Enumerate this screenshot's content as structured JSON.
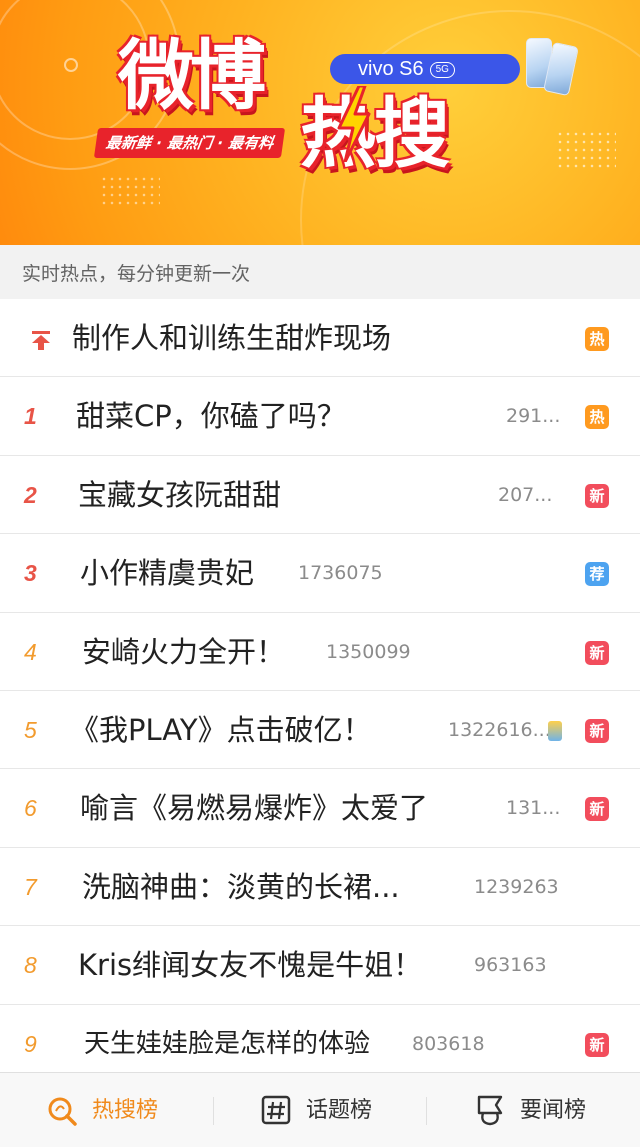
{
  "banner": {
    "title_1": "微博",
    "title_2": "热搜",
    "tagline": "最新鲜 · 最热门 · 最有料",
    "ad_brand": "vivo S6",
    "ad_badge": "5G",
    "colors": {
      "background": "#ffb321",
      "title_outline": "#e8232b",
      "pill": "#3b56e8"
    }
  },
  "subheader": "实时热点，每分钟更新一次",
  "list": [
    {
      "rank": "",
      "pinned": true,
      "title": "制作人和训练生甜炸现场",
      "count": "",
      "badge": "热",
      "badge_type": "hot"
    },
    {
      "rank": "1",
      "title": "甜菜CP，你磕了吗？",
      "count": "291...",
      "badge": "热",
      "badge_type": "hot"
    },
    {
      "rank": "2",
      "title": "宝藏女孩阮甜甜",
      "count": "207...",
      "badge": "新",
      "badge_type": "new"
    },
    {
      "rank": "3",
      "title": "小作精虞贵妃",
      "count": "1736075",
      "badge": "荐",
      "badge_type": "rec"
    },
    {
      "rank": "4",
      "title": "安崎火力全开！",
      "count": "1350099",
      "badge": "新",
      "badge_type": "new"
    },
    {
      "rank": "5",
      "title": "《我PLAY》点击破亿！",
      "count": "1322616...",
      "badge": "新",
      "badge_type": "new"
    },
    {
      "rank": "6",
      "title": "喻言《易燃易爆炸》太爱了",
      "count": "131...",
      "badge": "新",
      "badge_type": "new"
    },
    {
      "rank": "7",
      "title": "洗脑神曲：淡黄的长裙...",
      "count": "1239263",
      "badge": "",
      "badge_type": ""
    },
    {
      "rank": "8",
      "title": "Kris绯闻女友不愧是牛姐！",
      "count": "963163",
      "badge": "",
      "badge_type": ""
    },
    {
      "rank": "9",
      "title": "天生娃娃脸是怎样的体验",
      "count": "803618",
      "badge": "新",
      "badge_type": "new"
    }
  ],
  "tabs": [
    {
      "label": "热搜榜",
      "icon": "search-hot-icon",
      "active": true
    },
    {
      "label": "话题榜",
      "icon": "hashtag-icon",
      "active": false
    },
    {
      "label": "要闻榜",
      "icon": "news-icon",
      "active": false
    }
  ],
  "colors": {
    "rank_top": "#e85447",
    "rank_other": "#f29b2e",
    "badge_hot": "#ff9a1f",
    "badge_new": "#f24d5c",
    "badge_rec": "#4da3f0",
    "tab_active": "#f08a1c"
  }
}
